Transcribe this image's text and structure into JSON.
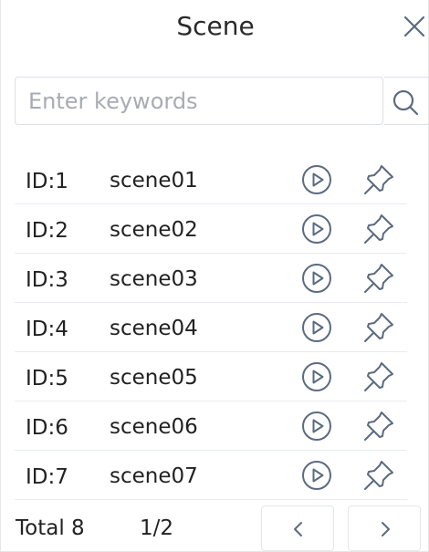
{
  "dialog": {
    "title": "Scene",
    "close_icon": "close-icon"
  },
  "search": {
    "placeholder": "Enter keywords",
    "value": "",
    "icon": "search-icon"
  },
  "scenes": [
    {
      "id": "ID:1",
      "name": "scene01"
    },
    {
      "id": "ID:2",
      "name": "scene02"
    },
    {
      "id": "ID:3",
      "name": "scene03"
    },
    {
      "id": "ID:4",
      "name": "scene04"
    },
    {
      "id": "ID:5",
      "name": "scene05"
    },
    {
      "id": "ID:6",
      "name": "scene06"
    },
    {
      "id": "ID:7",
      "name": "scene07"
    }
  ],
  "row_actions": {
    "play_icon": "play-circle-icon",
    "pin_icon": "pin-icon"
  },
  "pagination": {
    "total_label": "Total 8",
    "page_label": "1/2",
    "prev_icon": "chevron-left-icon",
    "next_icon": "chevron-right-icon"
  },
  "colors": {
    "icon": "#5b6b80",
    "border": "#dcdfe6",
    "text": "#222222"
  }
}
